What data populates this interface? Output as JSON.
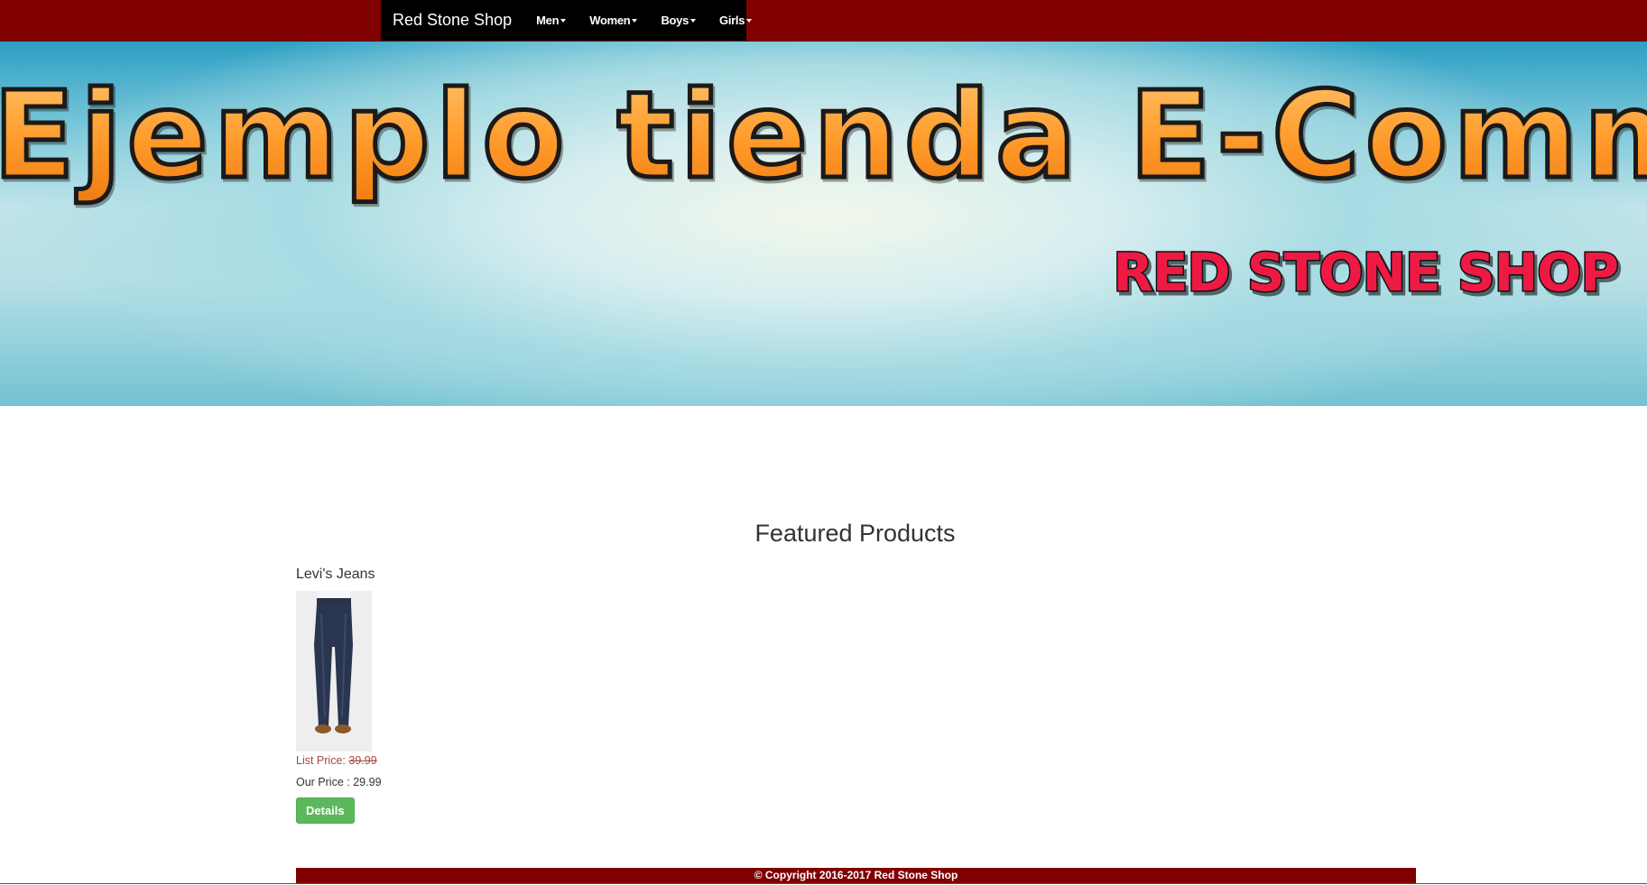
{
  "navbar": {
    "brand": "Red Stone Shop",
    "items": [
      {
        "label": "Men"
      },
      {
        "label": "Women"
      },
      {
        "label": "Boys"
      },
      {
        "label": "Girls"
      }
    ]
  },
  "banner": {
    "title": "Ejemplo tienda E-Commer",
    "logo_text": "RED STONE SHOP"
  },
  "main": {
    "heading": "Featured Products",
    "products": [
      {
        "name": "Levi's Jeans",
        "list_price_label": "List Price:",
        "list_price": "39.99",
        "our_price_label": "Our Price :",
        "our_price": "29.99",
        "button_label": "Details"
      }
    ]
  },
  "footer": {
    "text": "© Copyright 2016-2017 Red Stone Shop"
  },
  "colors": {
    "topbar": "#800000",
    "nav_bg": "#000000",
    "button": "#5cb85c",
    "list_price": "#a94442"
  }
}
